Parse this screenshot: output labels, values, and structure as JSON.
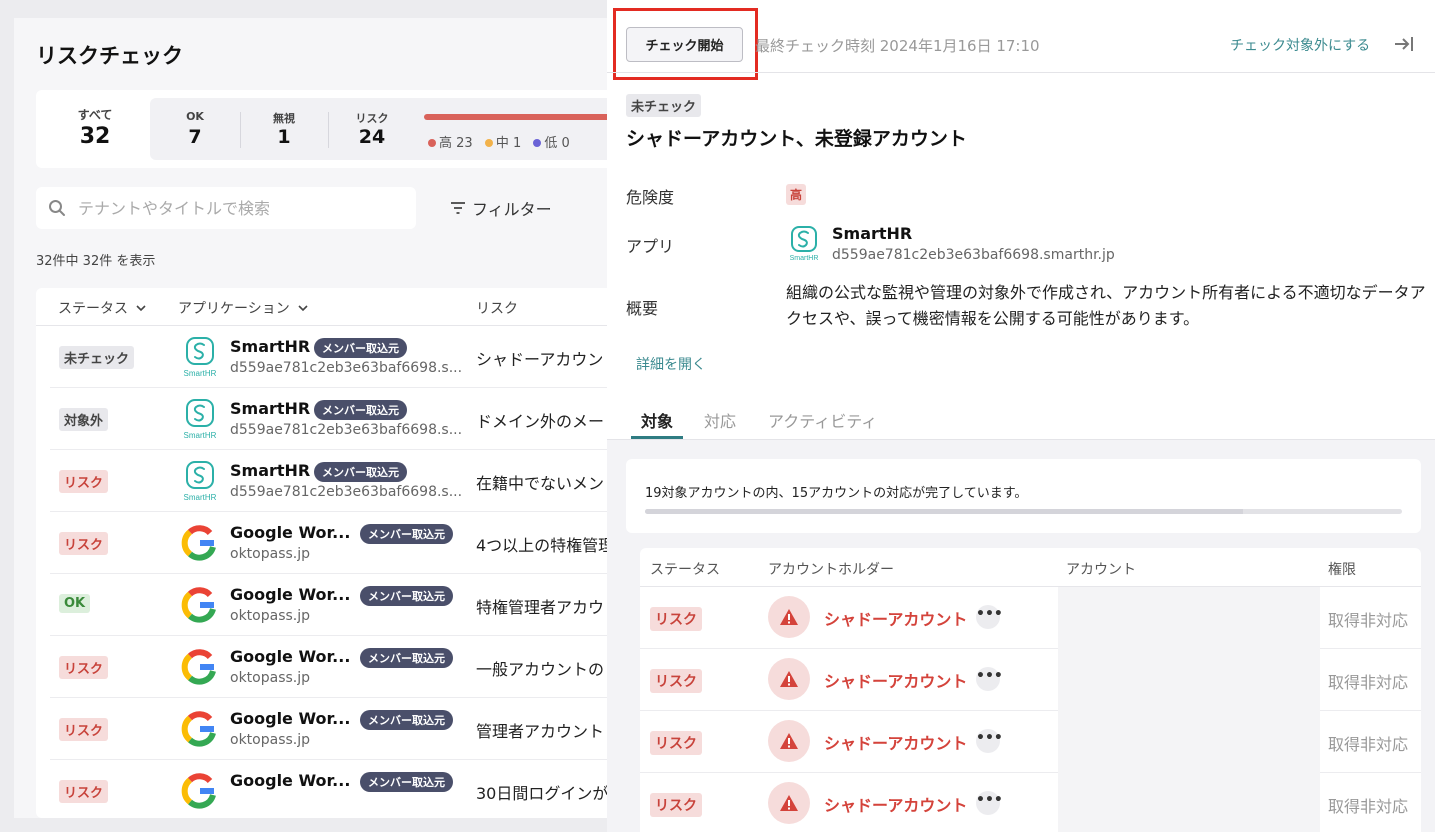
{
  "left": {
    "title": "リスクチェック",
    "summary": {
      "all_label": "すべて",
      "all_value": "32",
      "ok_label": "OK",
      "ok_value": "7",
      "ignore_label": "無視",
      "ignore_value": "1",
      "risk_label": "リスク",
      "risk_value": "24",
      "high_label": "高 23",
      "mid_label": "中 1",
      "low_label": "低 0",
      "colors": {
        "high": "#d9625a",
        "mid": "#f2b24a",
        "low": "#6b63d6"
      }
    },
    "search": {
      "placeholder": "テナントやタイトルで検索",
      "value": ""
    },
    "filter_label": "フィルター",
    "count_text": "32件中 32件 を表示",
    "columns": {
      "status": "ステータス",
      "application": "アプリケーション",
      "risk": "リスク"
    },
    "rows": [
      {
        "status": "未チェック",
        "app": "SmartHR",
        "tag": "メンバー取込元",
        "sub": "d559ae781c2eb3e63baf6698.s...",
        "risk": "シャドーアカウン"
      },
      {
        "status": "対象外",
        "app": "SmartHR",
        "tag": "メンバー取込元",
        "sub": "d559ae781c2eb3e63baf6698.s...",
        "risk": "ドメイン外のメー"
      },
      {
        "status": "リスク",
        "app": "SmartHR",
        "tag": "メンバー取込元",
        "sub": "d559ae781c2eb3e63baf6698.s...",
        "risk": "在籍中でないメン"
      },
      {
        "status": "リスク",
        "app": "Google Wor...",
        "tag": "メンバー取込元",
        "sub": "oktopass.jp",
        "risk": "4つ以上の特権管理"
      },
      {
        "status": "OK",
        "app": "Google Wor...",
        "tag": "メンバー取込元",
        "sub": "oktopass.jp",
        "risk": "特権管理者アカウ"
      },
      {
        "status": "リスク",
        "app": "Google Wor...",
        "tag": "メンバー取込元",
        "sub": "oktopass.jp",
        "risk": "一般アカウントの"
      },
      {
        "status": "リスク",
        "app": "Google Wor...",
        "tag": "メンバー取込元",
        "sub": "oktopass.jp",
        "risk": "管理者アカウント"
      },
      {
        "status": "リスク",
        "app": "Google Wor...",
        "tag": "メンバー取込元",
        "sub": "",
        "risk": "30日間ログインが"
      }
    ]
  },
  "right": {
    "start_button": "チェック開始",
    "last_check": "最終チェック時刻 2024年1月16日 17:10",
    "exclude_link": "チェック対象外にする",
    "status_tag": "未チェック",
    "title": "シャドーアカウント、未登録アカウント",
    "severity_label": "危険度",
    "severity_value": "高",
    "app_label": "アプリ",
    "app_name": "SmartHR",
    "app_sub": "d559ae781c2eb3e63baf6698.smarthr.jp",
    "app_icon_caption": "SmartHR",
    "overview_label": "概要",
    "overview_text": "組織の公式な監視や管理の対象外で作成され、アカウント所有者による不適切なデータアクセスや、誤って機密情報を公開する可能性があります。",
    "open_details": "詳細を開く",
    "tabs": [
      "対象",
      "対応",
      "アクティビティ"
    ],
    "progress": {
      "text": "19対象アカウントの内、15アカウントの対応が完了しています。",
      "done": 15,
      "total": 19
    },
    "accounts": {
      "columns": {
        "status": "ステータス",
        "holder": "アカウントホルダー",
        "account": "アカウント",
        "permission": "権限"
      },
      "rows": [
        {
          "status": "リスク",
          "holder": "シャドーアカウント",
          "more": "•••",
          "permission": "取得非対応"
        },
        {
          "status": "リスク",
          "holder": "シャドーアカウント",
          "more": "•••",
          "permission": "取得非対応"
        },
        {
          "status": "リスク",
          "holder": "シャドーアカウント",
          "more": "•••",
          "permission": "取得非対応"
        },
        {
          "status": "リスク",
          "holder": "シャドーアカウント",
          "more": "•••",
          "permission": "取得非対応"
        }
      ]
    },
    "accent_color": "#2f7c82",
    "highlight_color": "#e32b22"
  }
}
